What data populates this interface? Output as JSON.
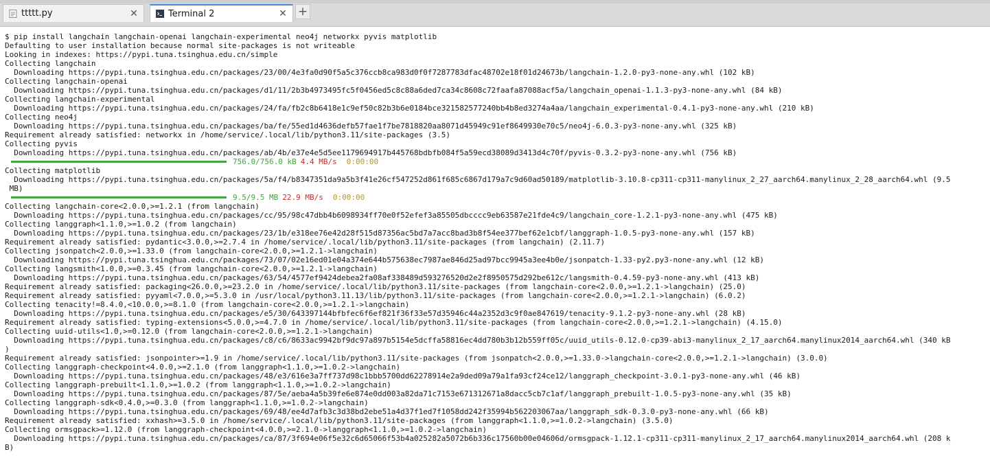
{
  "tabs": [
    {
      "label": "ttttt.py",
      "icon": "python-file-icon",
      "active": false
    },
    {
      "label": "Terminal 2",
      "icon": "terminal-icon",
      "active": true
    }
  ],
  "new_tab_label": "+",
  "close_label": "✕",
  "colors": {
    "progress_bar": "#43a33f",
    "size": "#43a33f",
    "speed": "#c03030",
    "eta": "#b39a2c",
    "active_tab_accent": "#4a8ad4"
  },
  "terminal": {
    "lines": [
      {
        "type": "text",
        "text": "$ pip install langchain langchain-openai langchain-experimental neo4j networkx pyvis matplotlib"
      },
      {
        "type": "text",
        "text": "Defaulting to user installation because normal site-packages is not writeable"
      },
      {
        "type": "text",
        "text": "Looking in indexes: https://pypi.tuna.tsinghua.edu.cn/simple"
      },
      {
        "type": "text",
        "text": "Collecting langchain"
      },
      {
        "type": "text",
        "text": "  Downloading https://pypi.tuna.tsinghua.edu.cn/packages/23/00/4e3fa0d90f5a5c376ccb8ca983d0f0f7287783dfac48702e18f01d24673b/langchain-1.2.0-py3-none-any.whl (102 kB)"
      },
      {
        "type": "text",
        "text": "Collecting langchain-openai"
      },
      {
        "type": "text",
        "text": "  Downloading https://pypi.tuna.tsinghua.edu.cn/packages/d1/11/2b3b4973495fc5f0456ed5c8c88a6ded7ca34c8608c72faafa87088acf5a/langchain_openai-1.1.3-py3-none-any.whl (84 kB)"
      },
      {
        "type": "text",
        "text": "Collecting langchain-experimental"
      },
      {
        "type": "text",
        "text": "  Downloading https://pypi.tuna.tsinghua.edu.cn/packages/24/fa/fb2c8b6418e1c9ef50c82b3b6e0184bce321582577240bb4b8ed3274a4aa/langchain_experimental-0.4.1-py3-none-any.whl (210 kB)"
      },
      {
        "type": "text",
        "text": "Collecting neo4j"
      },
      {
        "type": "text",
        "text": "  Downloading https://pypi.tuna.tsinghua.edu.cn/packages/ba/fe/55ed1d4636defb57fae1f7be7818820aa8071d45949c91ef8649930e70c5/neo4j-6.0.3-py3-none-any.whl (325 kB)"
      },
      {
        "type": "text",
        "text": "Requirement already satisfied: networkx in /home/service/.local/lib/python3.11/site-packages (3.5)"
      },
      {
        "type": "text",
        "text": "Collecting pyvis"
      },
      {
        "type": "text",
        "text": "  Downloading https://pypi.tuna.tsinghua.edu.cn/packages/ab/4b/e37e4e5d5ee1179694917b445768bdbfb084f5a59ecd38089d3413d4c70f/pyvis-0.3.2-py3-none-any.whl (756 kB)"
      },
      {
        "type": "progress",
        "fraction": 1.0,
        "size": "756.0/756.0 kB",
        "speed": "4.4 MB/s",
        "eta": "0:00:00"
      },
      {
        "type": "text",
        "text": "Collecting matplotlib"
      },
      {
        "type": "text",
        "text": "  Downloading https://pypi.tuna.tsinghua.edu.cn/packages/5a/f4/b8347351da9a5b3f41e26cf547252d861f685c6867d179a7c9d60ad50189/matplotlib-3.10.8-cp311-cp311-manylinux_2_27_aarch64.manylinux_2_28_aarch64.whl (9.5"
      },
      {
        "type": "text",
        "text": " MB)"
      },
      {
        "type": "progress",
        "fraction": 1.0,
        "size": "9.5/9.5 MB",
        "speed": "22.9 MB/s",
        "eta": "0:00:00"
      },
      {
        "type": "text",
        "text": "Collecting langchain-core<2.0.0,>=1.2.1 (from langchain)"
      },
      {
        "type": "text",
        "text": "  Downloading https://pypi.tuna.tsinghua.edu.cn/packages/cc/95/98c47dbb4b6098934ff70e0f52efef3a85505dbcccc9eb63587e21fde4c9/langchain_core-1.2.1-py3-none-any.whl (475 kB)"
      },
      {
        "type": "text",
        "text": "Collecting langgraph<1.1.0,>=1.0.2 (from langchain)"
      },
      {
        "type": "text",
        "text": "  Downloading https://pypi.tuna.tsinghua.edu.cn/packages/23/1b/e318ee76e42d28f515d87356ac5bd7a7acc8bad3b8f54ee377bef62e1cbf/langgraph-1.0.5-py3-none-any.whl (157 kB)"
      },
      {
        "type": "text",
        "text": "Requirement already satisfied: pydantic<3.0.0,>=2.7.4 in /home/service/.local/lib/python3.11/site-packages (from langchain) (2.11.7)"
      },
      {
        "type": "text",
        "text": "Collecting jsonpatch<2.0.0,>=1.33.0 (from langchain-core<2.0.0,>=1.2.1->langchain)"
      },
      {
        "type": "text",
        "text": "  Downloading https://pypi.tuna.tsinghua.edu.cn/packages/73/07/02e16ed01e04a374e644b575638ec7987ae846d25ad97bcc9945a3ee4b0e/jsonpatch-1.33-py2.py3-none-any.whl (12 kB)"
      },
      {
        "type": "text",
        "text": "Collecting langsmith<1.0.0,>=0.3.45 (from langchain-core<2.0.0,>=1.2.1->langchain)"
      },
      {
        "type": "text",
        "text": "  Downloading https://pypi.tuna.tsinghua.edu.cn/packages/63/54/4577ef9424debea2fa08af338489d593276520d2e2f8950575d292be612c/langsmith-0.4.59-py3-none-any.whl (413 kB)"
      },
      {
        "type": "text",
        "text": "Requirement already satisfied: packaging<26.0.0,>=23.2.0 in /home/service/.local/lib/python3.11/site-packages (from langchain-core<2.0.0,>=1.2.1->langchain) (25.0)"
      },
      {
        "type": "text",
        "text": "Requirement already satisfied: pyyaml<7.0.0,>=5.3.0 in /usr/local/python3.11.13/lib/python3.11/site-packages (from langchain-core<2.0.0,>=1.2.1->langchain) (6.0.2)"
      },
      {
        "type": "text",
        "text": "Collecting tenacity!=8.4.0,<10.0.0,>=8.1.0 (from langchain-core<2.0.0,>=1.2.1->langchain)"
      },
      {
        "type": "text",
        "text": "  Downloading https://pypi.tuna.tsinghua.edu.cn/packages/e5/30/643397144bfbfec6f6ef821f36f33e57d35946c44a2352d3c9f0ae847619/tenacity-9.1.2-py3-none-any.whl (28 kB)"
      },
      {
        "type": "text",
        "text": "Requirement already satisfied: typing-extensions<5.0.0,>=4.7.0 in /home/service/.local/lib/python3.11/site-packages (from langchain-core<2.0.0,>=1.2.1->langchain) (4.15.0)"
      },
      {
        "type": "text",
        "text": "Collecting uuid-utils<1.0,>=0.12.0 (from langchain-core<2.0.0,>=1.2.1->langchain)"
      },
      {
        "type": "text",
        "text": "  Downloading https://pypi.tuna.tsinghua.edu.cn/packages/c8/c6/8633ac9942bf9dc97a897b5154e5dcffa58816ec4dd780b3b12b559ff05c/uuid_utils-0.12.0-cp39-abi3-manylinux_2_17_aarch64.manylinux2014_aarch64.whl (340 kB"
      },
      {
        "type": "text",
        "text": ")"
      },
      {
        "type": "text",
        "text": "Requirement already satisfied: jsonpointer>=1.9 in /home/service/.local/lib/python3.11/site-packages (from jsonpatch<2.0.0,>=1.33.0->langchain-core<2.0.0,>=1.2.1->langchain) (3.0.0)"
      },
      {
        "type": "text",
        "text": "Collecting langgraph-checkpoint<4.0.0,>=2.1.0 (from langgraph<1.1.0,>=1.0.2->langchain)"
      },
      {
        "type": "text",
        "text": "  Downloading https://pypi.tuna.tsinghua.edu.cn/packages/48/e3/616e3a7ff737d98c1bbb5700dd62278914e2a9ded09a79a1fa93cf24ce12/langgraph_checkpoint-3.0.1-py3-none-any.whl (46 kB)"
      },
      {
        "type": "text",
        "text": "Collecting langgraph-prebuilt<1.1.0,>=1.0.2 (from langgraph<1.1.0,>=1.0.2->langchain)"
      },
      {
        "type": "text",
        "text": "  Downloading https://pypi.tuna.tsinghua.edu.cn/packages/87/5e/aeba4a5b39fe6e874e0dd003a82da71c7153e671312671a8dacc5cb7c1af/langgraph_prebuilt-1.0.5-py3-none-any.whl (35 kB)"
      },
      {
        "type": "text",
        "text": "Collecting langgraph-sdk<0.4.0,>=0.3.0 (from langgraph<1.1.0,>=1.0.2->langchain)"
      },
      {
        "type": "text",
        "text": "  Downloading https://pypi.tuna.tsinghua.edu.cn/packages/69/48/ee4d7afb3c3d38bd2ebe51a4d37f1ed7f1058dd242f35994b562203067aa/langgraph_sdk-0.3.0-py3-none-any.whl (66 kB)"
      },
      {
        "type": "text",
        "text": "Requirement already satisfied: xxhash>=3.5.0 in /home/service/.local/lib/python3.11/site-packages (from langgraph<1.1.0,>=1.0.2->langchain) (3.5.0)"
      },
      {
        "type": "text",
        "text": "Collecting ormsgpack>=1.12.0 (from langgraph-checkpoint<4.0.0,>=2.1.0->langgraph<1.1.0,>=1.0.2->langchain)"
      },
      {
        "type": "text",
        "text": "  Downloading https://pypi.tuna.tsinghua.edu.cn/packages/ca/87/3f694e06f5e32c6d65066f53b4a025282a5072b6b336c17560b00e04606d/ormsgpack-1.12.1-cp311-cp311-manylinux_2_17_aarch64.manylinux2014_aarch64.whl (208 k"
      },
      {
        "type": "text",
        "text": "B)"
      }
    ]
  }
}
